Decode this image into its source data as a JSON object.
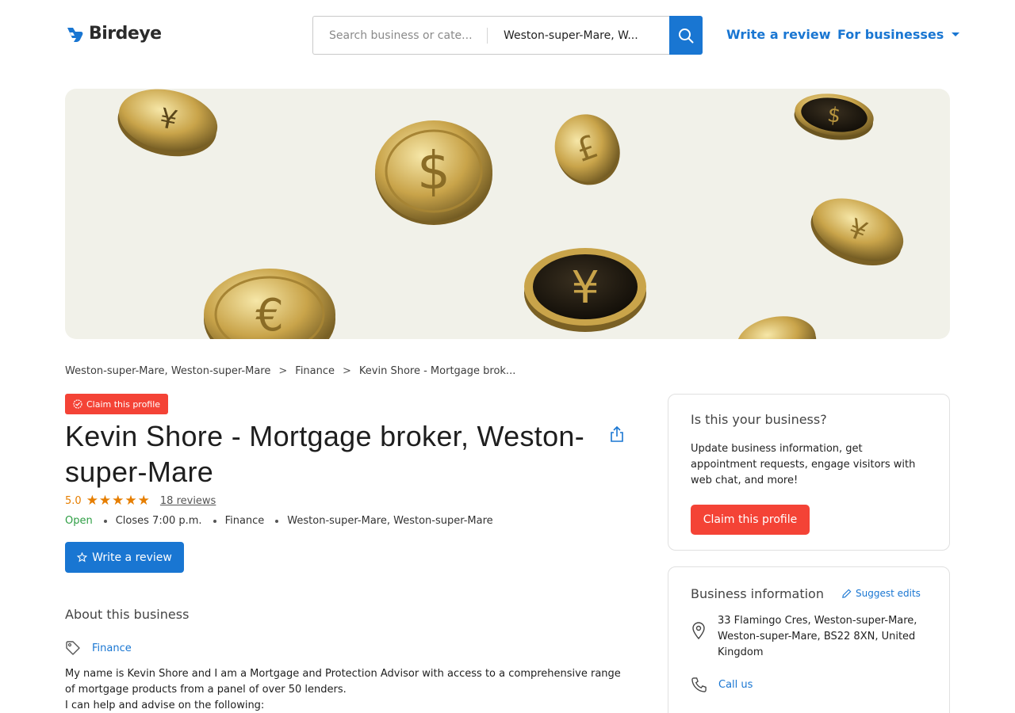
{
  "header": {
    "logo_text": "Birdeye",
    "search_placeholder": "Search business or cate...",
    "location_value": "Weston-super-Mare, W...",
    "write_review": "Write a review",
    "for_businesses": "For businesses"
  },
  "breadcrumb": [
    "Weston-super-Mare, Weston-super-Mare",
    "Finance",
    "Kevin Shore - Mortgage brok..."
  ],
  "profile": {
    "claim_badge": "Claim this profile",
    "title": "Kevin Shore - Mortgage broker, Weston-super-Mare",
    "rating": "5.0",
    "stars": "★★★★★",
    "review_count": "18 reviews",
    "status": "Open",
    "hours": "Closes 7:00 p.m.",
    "category": "Finance",
    "location": "Weston-super-Mare, Weston-super-Mare",
    "write_review_btn": "Write a review"
  },
  "about": {
    "heading": "About this business",
    "category_link": "Finance",
    "description_1": "My name is Kevin Shore and I am a Mortgage and Protection Advisor with access to a comprehensive range of mortgage products from a panel of over 50 lenders.",
    "description_2": "I can help and advise on the following:"
  },
  "claim_card": {
    "heading": "Is this your business?",
    "text": "Update business information, get appointment requests, engage visitors with web chat, and more!",
    "button": "Claim this profile"
  },
  "info_card": {
    "heading": "Business information",
    "suggest_edits": "Suggest edits",
    "address": "33 Flamingo Cres, Weston-super-Mare, Weston-super-Mare, BS22 8XN, United Kingdom",
    "call": "Call us"
  },
  "colors": {
    "accent": "#1976d2",
    "danger": "#f44336",
    "star": "#e67e00",
    "open": "#2e9e44",
    "banner_bg": "#f1f1e9"
  }
}
